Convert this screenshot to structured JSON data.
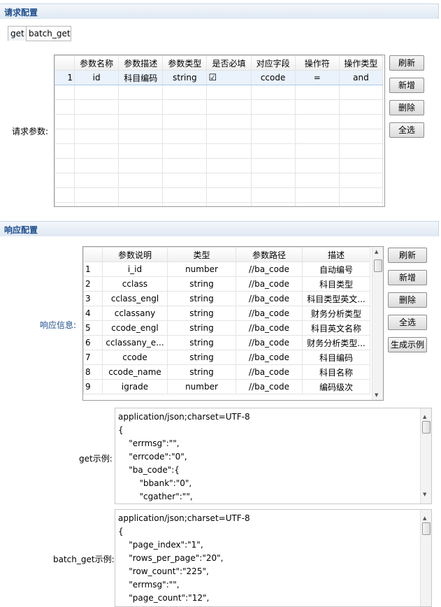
{
  "request": {
    "title": "请求配置",
    "tabs": [
      "get",
      "batch_get"
    ],
    "label": "请求参数:",
    "columns": [
      "",
      "参数名称",
      "参数描述",
      "参数类型",
      "是否必填",
      "对应字段",
      "操作符",
      "操作类型"
    ],
    "rows": [
      {
        "n": "1",
        "name": "id",
        "desc": "科目编码",
        "type": "string",
        "required": true,
        "field": "ccode",
        "op": "=",
        "optype": "and"
      }
    ],
    "buttons": [
      "刷新",
      "新增",
      "删除",
      "全选"
    ]
  },
  "response": {
    "title": "响应配置",
    "label": "响应信息:",
    "columns": [
      "",
      "参数说明",
      "类型",
      "参数路径",
      "描述"
    ],
    "rows": [
      [
        "1",
        "i_id",
        "number",
        "//ba_code",
        "自动编号"
      ],
      [
        "2",
        "cclass",
        "string",
        "//ba_code",
        "科目类型"
      ],
      [
        "3",
        "cclass_engl",
        "string",
        "//ba_code",
        "科目类型英文..."
      ],
      [
        "4",
        "cclassany",
        "string",
        "//ba_code",
        "财务分析类型"
      ],
      [
        "5",
        "ccode_engl",
        "string",
        "//ba_code",
        "科目英文名称"
      ],
      [
        "6",
        "cclassany_e...",
        "string",
        "//ba_code",
        "财务分析类型..."
      ],
      [
        "7",
        "ccode",
        "string",
        "//ba_code",
        "科目编码"
      ],
      [
        "8",
        "ccode_name",
        "string",
        "//ba_code",
        "科目名称"
      ],
      [
        "9",
        "igrade",
        "number",
        "//ba_code",
        "编码级次"
      ]
    ],
    "buttons": [
      "刷新",
      "新增",
      "删除",
      "全选",
      "生成示例"
    ]
  },
  "get_example": {
    "label": "get示例:",
    "text": "application/json;charset=UTF-8\n{\n\t\"errmsg\":\"\",\n\t\"errcode\":\"0\",\n\t\"ba_code\":{\n\t\t\"bbank\":\"0\",\n\t\t\"cgather\":\"\","
  },
  "batch_get_example": {
    "label": "batch_get示例:",
    "text": "application/json;charset=UTF-8\n{\n\t\"page_index\":\"1\",\n\t\"rows_per_page\":\"20\",\n\t\"row_count\":\"225\",\n\t\"errmsg\":\"\",\n\t\"page_count\":\"12\","
  }
}
